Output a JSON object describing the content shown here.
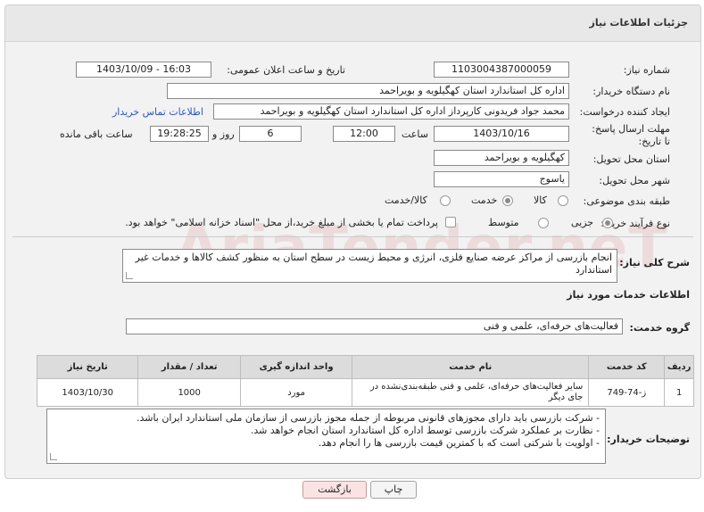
{
  "header": {
    "title": "جزئیات اطلاعات نیاز"
  },
  "fields": {
    "need_number": {
      "label": "شماره نیاز:",
      "value": "1103004387000059"
    },
    "announce_datetime": {
      "label": "تاریخ و ساعت اعلان عمومی:",
      "value": "1403/10/09 - 16:03"
    },
    "buyer_org": {
      "label": "نام دستگاه خریدار:",
      "value": "اداره کل استاندارد استان کهگیلویه و بویراحمد"
    },
    "requester": {
      "label": "ایجاد کننده درخواست:",
      "value": "محمد جواد  فریدونی کارپرداز اداره کل استاندارد استان کهگیلویه و بویراحمد",
      "contact_link": "اطلاعات تماس خریدار"
    },
    "deadline": {
      "label": "مهلت ارسال پاسخ: تا تاریخ:",
      "date": "1403/10/16",
      "time_label": "ساعت",
      "time": "12:00",
      "days": "6",
      "days_label": "روز و",
      "remaining": "19:28:25",
      "remaining_label": "ساعت باقی مانده"
    },
    "delivery_province": {
      "label": "استان محل تحویل:",
      "value": "کهگیلویه و بویراحمد"
    },
    "delivery_city": {
      "label": "شهر محل تحویل:",
      "value": "یاسوج"
    },
    "category": {
      "label": "طبقه بندی موضوعی:",
      "options": [
        "کالا",
        "خدمت",
        "کالا/خدمت"
      ],
      "selected": "خدمت"
    },
    "process_type": {
      "label": "نوع فرآیند خرید :",
      "options": [
        "جزیی",
        "متوسط"
      ],
      "selected": "جزیی",
      "note": "پرداخت تمام یا بخشی از مبلغ خرید،از محل \"اسناد خزانه اسلامی\" خواهد بود."
    }
  },
  "summary": {
    "label": "شرح کلی نیاز:",
    "text": "انجام بازرسی از مراکز عرضه صنایع فلزی، انرژی و محیط زیست در سطح استان به منظور کشف کالاها و خدمات غیر استاندارد"
  },
  "services": {
    "section_title": "اطلاعات خدمات مورد نیاز",
    "group_label": "گروه خدمت:",
    "group_value": "فعالیت‌های حرفه‌ای، علمی و فنی",
    "columns": [
      "ردیف",
      "کد خدمت",
      "نام خدمت",
      "واحد اندازه گیری",
      "تعداد / مقدار",
      "تاریخ نیاز"
    ],
    "rows": [
      [
        "1",
        "ز-74-749",
        "سایر فعالیت‌های حرفه‌ای، علمی و فنی طبقه‌بندی‌نشده در جای دیگر",
        "مورد",
        "1000",
        "1403/10/30"
      ]
    ]
  },
  "buyer_notes": {
    "label": "توضیحات خریدار:",
    "lines": [
      "- شرکت بازرسی باید دارای مجوزهای قانونی مربوطه از جمله مجوز بازرسی از سازمان ملی استاندارد ایران باشد.",
      "- نظارت بر عملکرد شرکت بازرسی توسط اداره کل استاندارد استان انجام خواهد شد.",
      "- اولویت با شرکتی است که با کمترین قیمت بازرسی ها را انجام دهد."
    ]
  },
  "buttons": {
    "print": "چاپ",
    "back": "بازگشت"
  },
  "watermark": "AriaTender.neT"
}
